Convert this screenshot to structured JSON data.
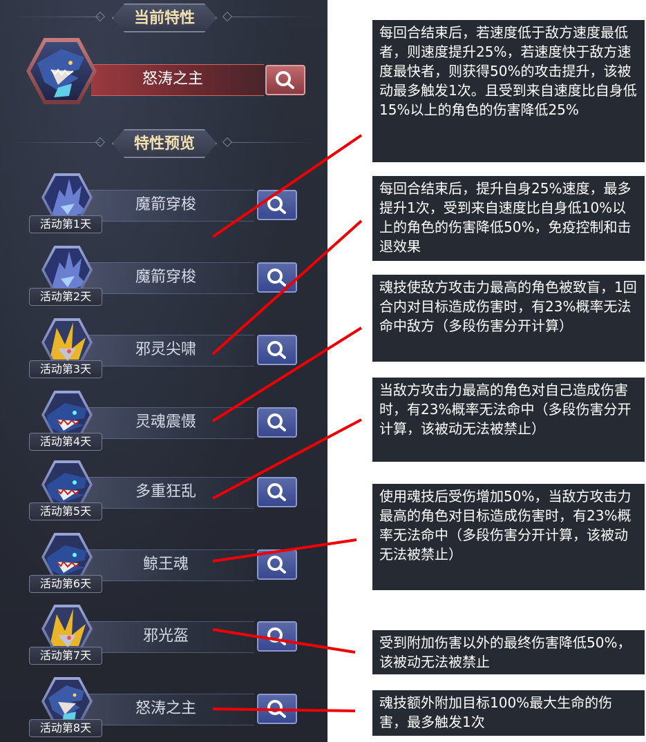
{
  "current_section": {
    "title": "当前特性"
  },
  "current_trait": {
    "name": "怒涛之主"
  },
  "preview_section": {
    "title": "特性预览"
  },
  "traits": [
    {
      "day_label": "活动第1天",
      "name": "魔箭穿梭",
      "art": "spike-dragon"
    },
    {
      "day_label": "活动第2天",
      "name": "魔箭穿梭",
      "art": "spike-dragon"
    },
    {
      "day_label": "活动第3天",
      "name": "邪灵尖啸",
      "art": "gold-horn"
    },
    {
      "day_label": "活动第4天",
      "name": "灵魂震慑",
      "art": "whale"
    },
    {
      "day_label": "活动第5天",
      "name": "多重狂乱",
      "art": "whale"
    },
    {
      "day_label": "活动第6天",
      "name": "鲸王魂",
      "art": "whale"
    },
    {
      "day_label": "活动第7天",
      "name": "邪光盔",
      "art": "gold-horn"
    },
    {
      "day_label": "活动第8天",
      "name": "怒涛之主",
      "art": "shark"
    }
  ],
  "descriptions": [
    "每回合结束后，若速度低于敌方速度最低者，则速度提升25%，若速度快于敌方速度最快者，则获得50%的攻击提升，该被动最多触发1次。且受到来自速度比自身低15%以上的角色的伤害降低25%",
    "每回合结束后，提升自身25%速度，最多提升1次，受到来自速度比自身低10%以上的角色的伤害降低50%，免疫控制和击退效果",
    "魂技使敌方攻击力最高的角色被致盲，1回合内对目标造成伤害时，有23%概率无法命中敌方（多段伤害分开计算）",
    "当敌方攻击力最高的角色对自己造成伤害时，有23%概率无法命中（多段伤害分开计算，该被动无法被禁止）",
    "使用魂技后受伤增加50%，当敌方攻击力最高的角色对目标造成伤害时，有23%概率无法命中（多段伤害分开计算，该被动无法被禁止）",
    "受到附加伤害以外的最终伤害降低50%，该被动无法被禁止",
    "魂技额外附加目标100%最大生命的伤害，最多触发1次"
  ],
  "colors": {
    "annotation_line": "#ee0000",
    "desc_bg": "#262a33",
    "panel_bg": "#262a35",
    "title_text": "#f3e2b0"
  },
  "icons": {
    "search": "magnifier-icon"
  }
}
